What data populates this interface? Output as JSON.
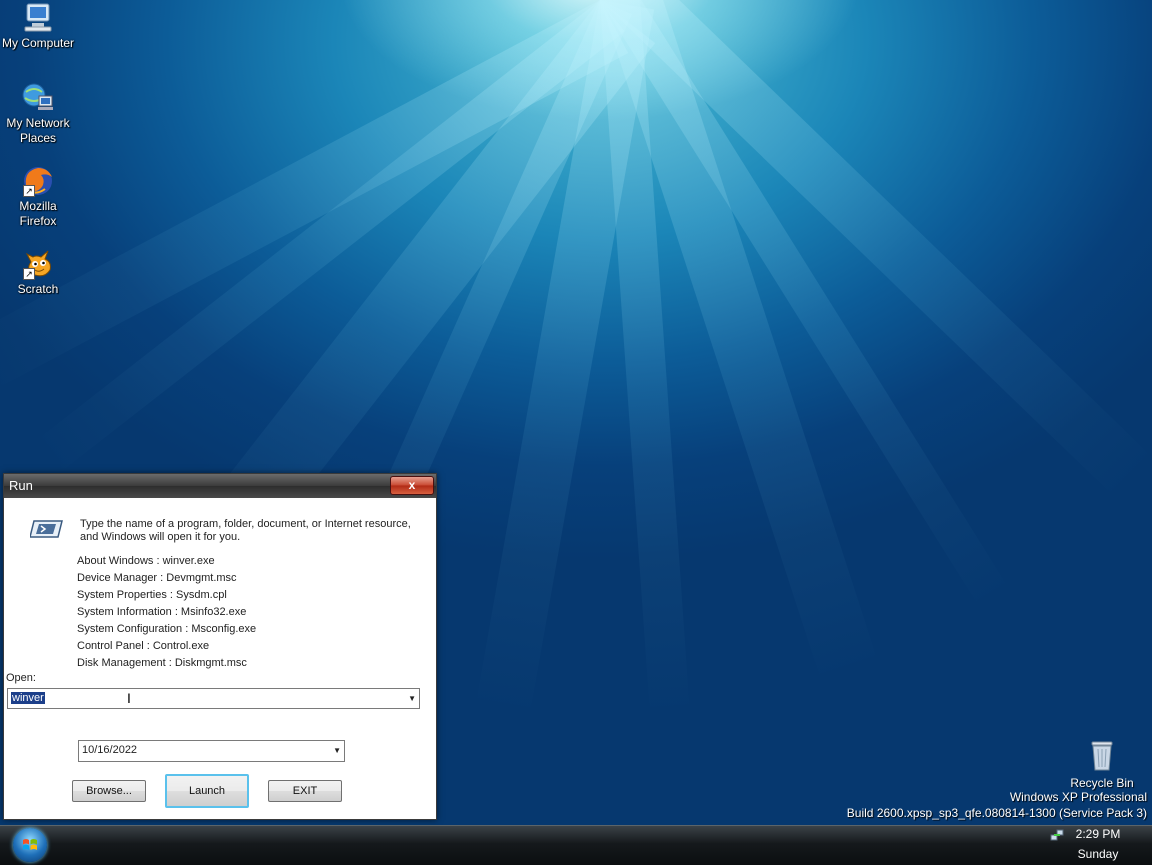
{
  "desktop": {
    "icons": [
      {
        "label": "My Computer",
        "icon": "computer-icon"
      },
      {
        "label": "My Network\nPlaces",
        "icon": "network-icon"
      },
      {
        "label": "Mozilla\nFirefox",
        "icon": "firefox-icon"
      },
      {
        "label": "Scratch",
        "icon": "scratch-icon"
      }
    ],
    "recycle_bin": "Recycle Bin",
    "os_name": "Windows XP Professional",
    "os_build": "Build 2600.xpsp_sp3_qfe.080814-1300 (Service Pack 3)"
  },
  "run_dialog": {
    "title": "Run",
    "close": "x",
    "instruction": "Type the name of a program, folder, document, or Internet resource, and Windows will open it for you.",
    "hints": [
      "About Windows : winver.exe",
      "Device Manager : Devmgmt.msc",
      "System Properties : Sysdm.cpl",
      "System Information : Msinfo32.exe",
      "System Configuration : Msconfig.exe",
      "Control Panel : Control.exe",
      "Disk Management : Diskmgmt.msc"
    ],
    "open_label": "Open:",
    "open_value": "winver",
    "date_value": "10/16/2022",
    "buttons": {
      "browse": "Browse...",
      "launch": "Launch",
      "exit": "EXIT"
    }
  },
  "taskbar": {
    "time": "2:29 PM",
    "day": "Sunday"
  },
  "colors": {
    "selection": "#1c3f8a",
    "default_button_border": "#5ac1ec"
  }
}
